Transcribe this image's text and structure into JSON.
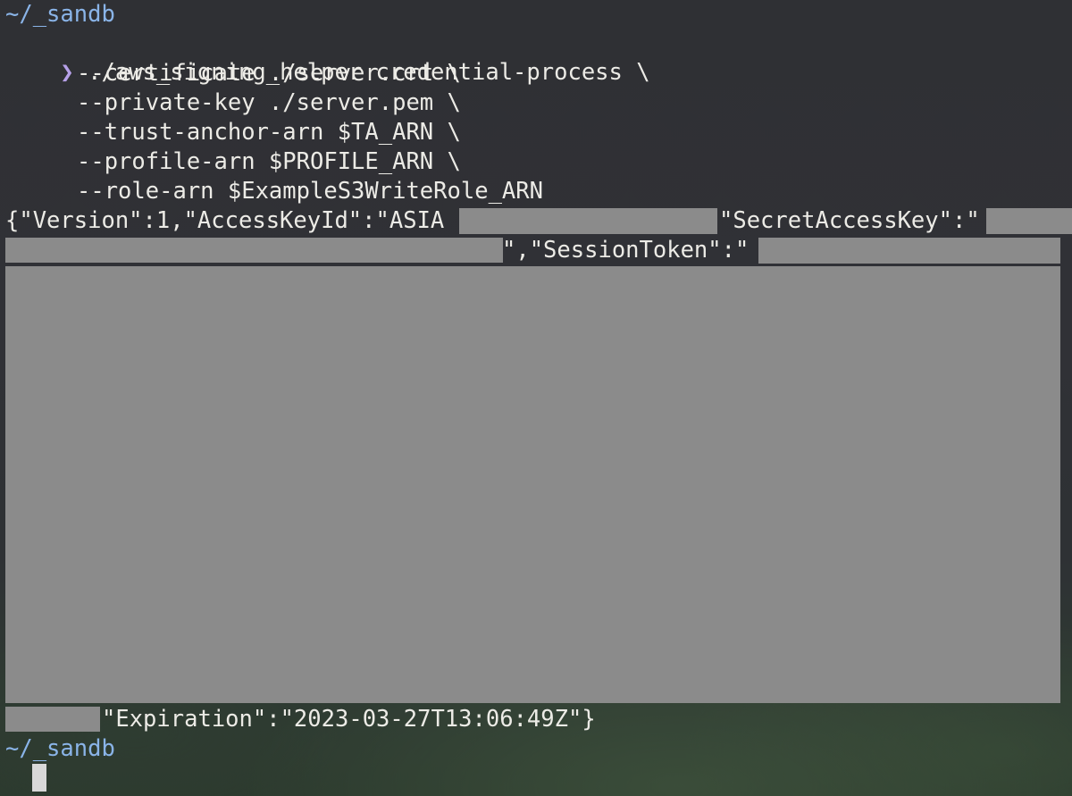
{
  "terminal": {
    "cwd": "~/_sandb",
    "prompt_symbol": "❯",
    "command": {
      "line1": " ./aws_signing_helper credential-process \\",
      "line2": "--certificate ./server.crt \\",
      "line3": "--private-key ./server.pem \\",
      "line4": "--trust-anchor-arn $TA_ARN \\",
      "line5": "--profile-arn $PROFILE_ARN \\",
      "line6": "--role-arn $ExampleS3WriteRole_ARN"
    },
    "output": {
      "part_version": "{\"Version\":1,\"AccessKeyId\":\"ASIA",
      "part_secret_key": "\"SecretAccessKey\":\"",
      "part_session_token": "\",\"SessionToken\":\"",
      "part_expiration": "\"Expiration\":\"2023-03-27T13:06:49Z\"}"
    },
    "cwd_after": "~/_sandb",
    "prompt_symbol_after": "❯"
  }
}
